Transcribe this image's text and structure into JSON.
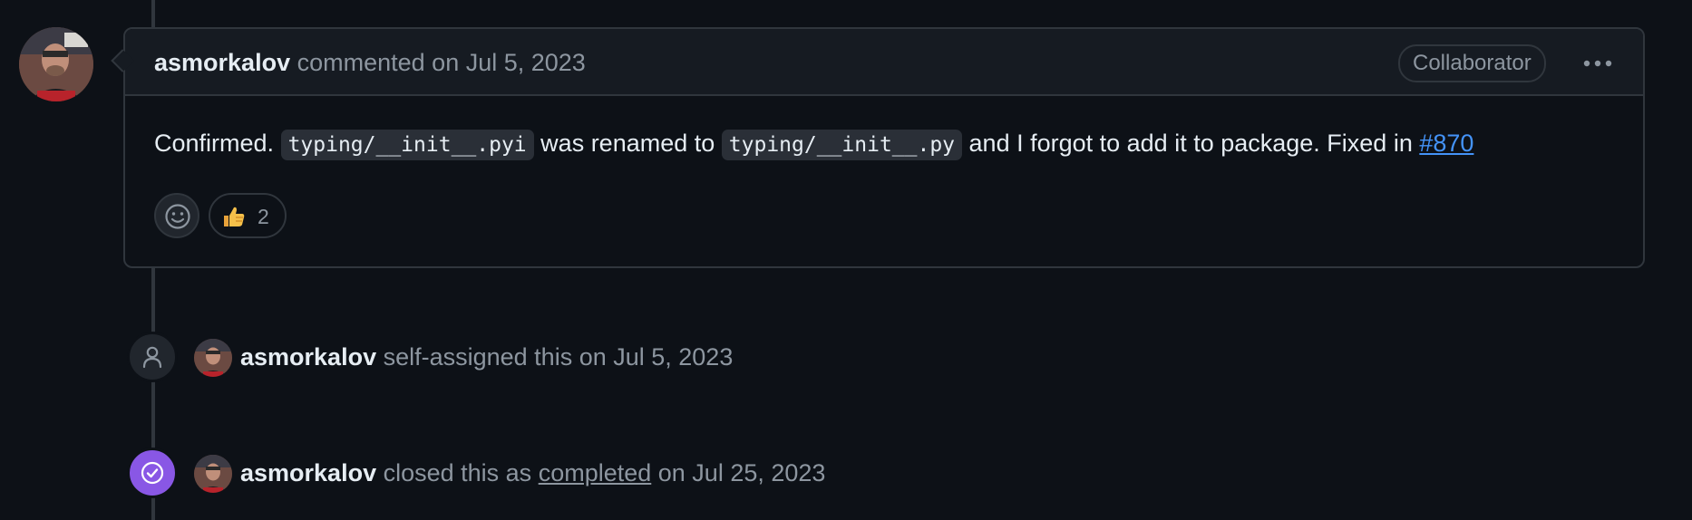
{
  "comment": {
    "author": "asmorkalov",
    "action": "commented on Jul 5, 2023",
    "badge": "Collaborator",
    "more_icon": "kebab-horizontal-icon",
    "body": {
      "part1": "Confirmed. ",
      "code1": "typing/__init__.pyi",
      "part2": " was renamed to ",
      "code2": "typing/__init__.py",
      "part3": " and I forgot to add it to package. Fixed in ",
      "link": "#870"
    },
    "reactions": {
      "add_icon": "smiley-icon",
      "thumbs_up_count": "2"
    }
  },
  "events": [
    {
      "icon": "person-icon",
      "author": "asmorkalov",
      "text": " self-assigned this on Jul 5, 2023"
    },
    {
      "icon": "check-circle-icon",
      "author": "asmorkalov",
      "text_before": " closed this as ",
      "link": "completed",
      "text_after": " on Jul 25, 2023"
    }
  ],
  "colors": {
    "background": "#0d1117",
    "border": "#30363d",
    "muted": "#8d96a0",
    "link": "#4493f8",
    "closed_purple": "#8957e5"
  }
}
